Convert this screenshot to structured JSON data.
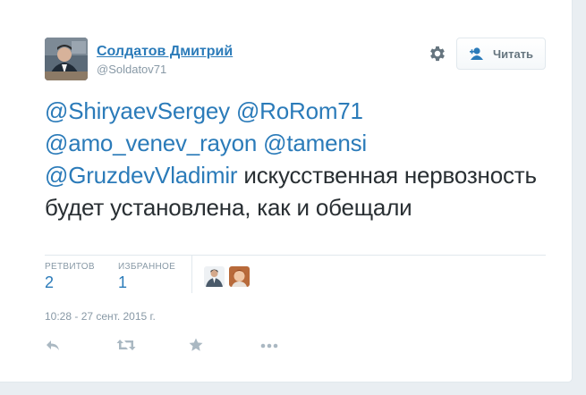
{
  "author": {
    "name": "Солдатов Дмитрий",
    "handle": "@Soldatov71"
  },
  "follow_button": {
    "label": "Читать"
  },
  "tweet": {
    "mentions": [
      "@ShiryaevSergey",
      "@RoRom71",
      "@amo_venev_rayon",
      "@tamensi",
      "@GruzdevVladimir"
    ],
    "body": "искусственная нервозность будет установлена, как и обещали"
  },
  "stats": {
    "retweets_label": "РЕТВИТОВ",
    "retweets_value": "2",
    "favorites_label": "ИЗБРАННОЕ",
    "favorites_value": "1"
  },
  "timestamp": "10:28 - 27 сент. 2015 г.",
  "icons": [
    "gear-icon",
    "add-user-icon",
    "reply-icon",
    "retweet-icon",
    "favorite-icon",
    "more-icon"
  ],
  "colors": {
    "link": "#2b7bb9",
    "text": "#292f33",
    "muted": "#8899a6",
    "background": "#e9eef2"
  }
}
